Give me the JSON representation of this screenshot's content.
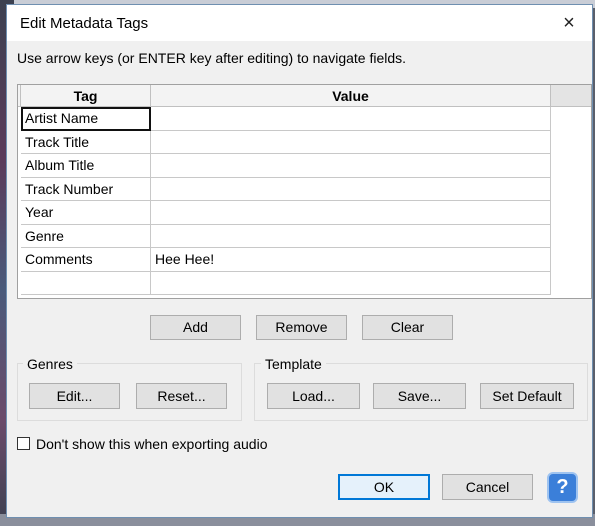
{
  "window": {
    "title": "Edit Metadata Tags",
    "close_icon": "×"
  },
  "instruction": "Use arrow keys (or ENTER key after editing) to navigate fields.",
  "table": {
    "headers": {
      "tag": "Tag",
      "value": "Value"
    },
    "rows": [
      {
        "tag": "Artist Name",
        "value": ""
      },
      {
        "tag": "Track Title",
        "value": ""
      },
      {
        "tag": "Album Title",
        "value": ""
      },
      {
        "tag": "Track Number",
        "value": ""
      },
      {
        "tag": "Year",
        "value": ""
      },
      {
        "tag": "Genre",
        "value": ""
      },
      {
        "tag": "Comments",
        "value": "Hee Hee!"
      },
      {
        "tag": "",
        "value": ""
      }
    ]
  },
  "row_buttons": {
    "add": "Add",
    "remove": "Remove",
    "clear": "Clear"
  },
  "genres": {
    "label": "Genres",
    "edit": "Edit...",
    "reset": "Reset..."
  },
  "template": {
    "label": "Template",
    "load": "Load...",
    "save": "Save...",
    "set_default": "Set Default"
  },
  "dont_show": {
    "label": "Don't show this when exporting audio",
    "checked": false
  },
  "footer": {
    "ok": "OK",
    "cancel": "Cancel",
    "help": "?"
  },
  "colors": {
    "accent": "#0078d7",
    "help_button": "#3b7fd9"
  }
}
